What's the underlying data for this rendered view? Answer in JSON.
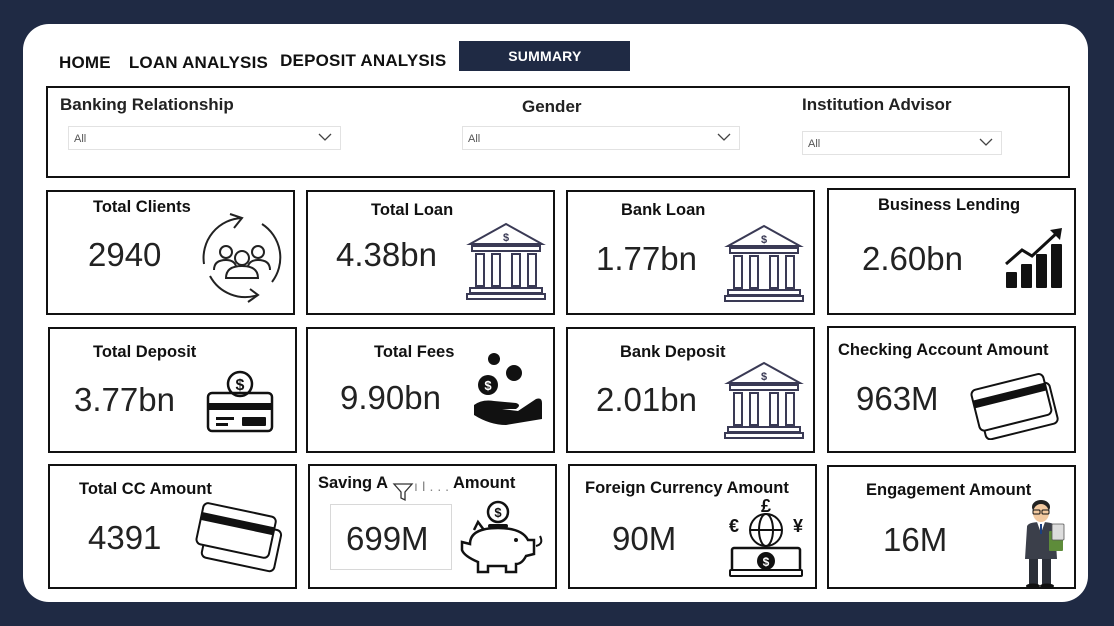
{
  "nav": {
    "home": "HOME",
    "loan_analysis": "LOAN ANALYSIS",
    "deposit_analysis": "DEPOSIT ANALYSIS",
    "summary": "SUMMARY"
  },
  "filters": {
    "banking_relationship": {
      "label": "Banking Relationship",
      "value": "All"
    },
    "gender": {
      "label": "Gender",
      "value": "All"
    },
    "institution_advisor": {
      "label": "Institution Advisor",
      "value": "All"
    }
  },
  "cards": {
    "total_clients": {
      "title": "Total Clients",
      "value": "2940",
      "icon": "clients-cycle-icon"
    },
    "total_loan": {
      "title": "Total Loan",
      "value": "4.38bn",
      "icon": "bank-icon"
    },
    "bank_loan": {
      "title": "Bank Loan",
      "value": "1.77bn",
      "icon": "bank-icon"
    },
    "business_lending": {
      "title": "Business Lending",
      "value": "2.60bn",
      "icon": "growth-chart-icon"
    },
    "total_deposit": {
      "title": "Total Deposit",
      "value": "3.77bn",
      "icon": "card-dollar-icon"
    },
    "total_fees": {
      "title": "Total Fees",
      "value": "9.90bn",
      "icon": "hand-coins-icon"
    },
    "bank_deposit": {
      "title": "Bank Deposit",
      "value": "2.01bn",
      "icon": "bank-icon"
    },
    "checking_account": {
      "title": "Checking Account Amount",
      "value": "963M",
      "icon": "credit-cards-icon"
    },
    "total_cc": {
      "title": "Total CC Amount",
      "value": "4391",
      "icon": "credit-cards-icon"
    },
    "saving_account": {
      "title_left": "Saving A",
      "title_right": "Amount",
      "value": "699M",
      "icon": "piggy-bank-icon"
    },
    "foreign_currency": {
      "title": "Foreign Currency Amount",
      "value": "90M",
      "icon": "currency-exchange-icon"
    },
    "engagement": {
      "title": "Engagement Amount",
      "value": "16M",
      "icon": "businessman-icon"
    }
  },
  "colors": {
    "navy": "#1f2a44",
    "border": "#111111"
  }
}
